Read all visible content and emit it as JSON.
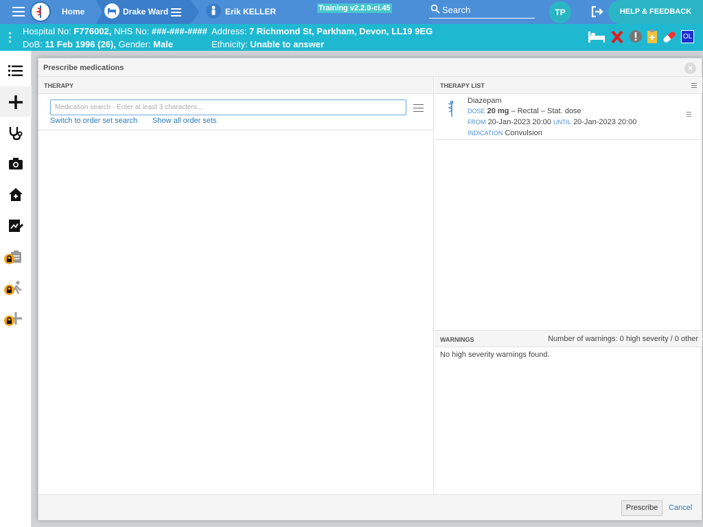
{
  "topbar": {
    "home_label": "Home",
    "ward_label": "Drake Ward",
    "patient_label": "Erik KELLER",
    "training_label": "Training v2.2.0-ci.45",
    "search_label": "Search",
    "avatar_initials": "TP",
    "help_label": "HELP & FEEDBACK"
  },
  "banner": {
    "hospital_no_label": "Hospital No:",
    "hospital_no": "F776002,",
    "nhs_no_label": "NHS No:",
    "nhs_no": "###-###-####",
    "address_label": "Address:",
    "address": "7 Richmond St, Parkham, Devon, LL19 9EG",
    "dob_label": "DoB:",
    "dob": "11 Feb 1996 (26),",
    "gender_label": "Gender:",
    "gender": "Male",
    "ethnicity_label": "Ethnicity:",
    "ethnicity": "Unable to answer",
    "badge_ol": "OL"
  },
  "modal": {
    "title": "Prescribe medications",
    "therapy_header": "THERAPY",
    "search_placeholder": "Medication search - Enter at least 3 characters...",
    "switch_link": "Switch to order set search",
    "show_all_link": "Show all order sets",
    "therapy_list_header": "THERAPY LIST",
    "therapy": {
      "name": "Diazepam",
      "dose_key": "DOSE",
      "dose_value": "20 mg",
      "route_freq": "– Rectal – Stat. dose",
      "from_key": "FROM",
      "from_value": "20-Jan-2023 20:00",
      "until_key": "UNTIL",
      "until_value": "20-Jan-2023 20:00",
      "indication_key": "INDICATION",
      "indication_value": "Convulsion"
    },
    "warnings_header": "WARNINGS",
    "warnings_count": "Number of warnings: 0 high severity / 0 other",
    "no_warnings": "No high severity warnings found.",
    "prescribe_label": "Prescribe",
    "cancel_label": "Cancel"
  },
  "colors": {
    "topbar": "#4a8fd8",
    "banner": "#1fb8d1",
    "accent_teal": "#2bb5c4",
    "link": "#2a7ab8",
    "lock": "#f39c12"
  },
  "nav_icons": [
    "list-icon",
    "plus-icon",
    "stethoscope-icon",
    "camera-icon",
    "home-medical-icon",
    "chart-edit-icon",
    "clipboard-locked-icon",
    "person-walking-locked-icon",
    "plus-locked-icon"
  ]
}
